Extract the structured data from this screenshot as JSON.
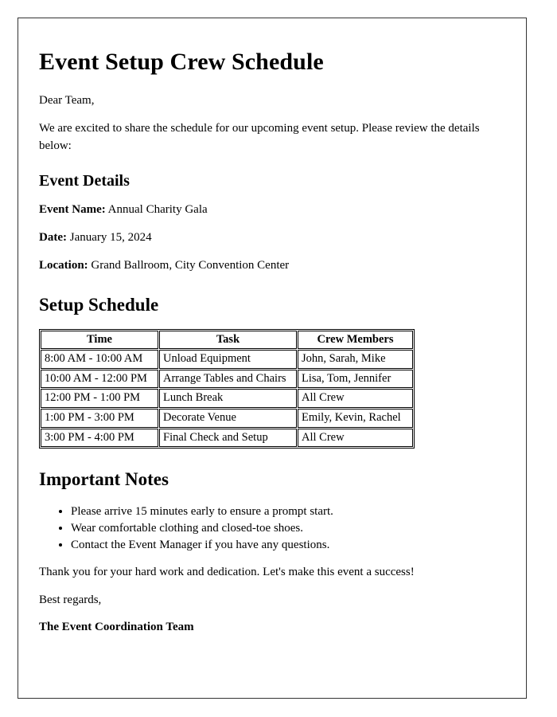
{
  "document": {
    "title": "Event Setup Crew Schedule",
    "greeting": "Dear Team,",
    "intro": "We are excited to share the schedule for our upcoming event setup. Please review the details below:"
  },
  "event_details": {
    "heading": "Event Details",
    "fields": [
      {
        "label": "Event Name:",
        "value": "Annual Charity Gala"
      },
      {
        "label": "Date:",
        "value": "January 15, 2024"
      },
      {
        "label": "Location:",
        "value": "Grand Ballroom, City Convention Center"
      }
    ]
  },
  "setup_schedule": {
    "heading": "Setup Schedule",
    "columns": [
      "Time",
      "Task",
      "Crew Members"
    ],
    "rows": [
      [
        "8:00 AM - 10:00 AM",
        "Unload Equipment",
        "John, Sarah, Mike"
      ],
      [
        "10:00 AM - 12:00 PM",
        "Arrange Tables and Chairs",
        "Lisa, Tom, Jennifer"
      ],
      [
        "12:00 PM - 1:00 PM",
        "Lunch Break",
        "All Crew"
      ],
      [
        "1:00 PM - 3:00 PM",
        "Decorate Venue",
        "Emily, Kevin, Rachel"
      ],
      [
        "3:00 PM - 4:00 PM",
        "Final Check and Setup",
        "All Crew"
      ]
    ]
  },
  "important_notes": {
    "heading": "Important Notes",
    "items": [
      "Please arrive 15 minutes early to ensure a prompt start.",
      "Wear comfortable clothing and closed-toe shoes.",
      "Contact the Event Manager if you have any questions."
    ]
  },
  "closing": {
    "thanks": "Thank you for your hard work and dedication. Let's make this event a success!",
    "regards": "Best regards,",
    "signature": "The Event Coordination Team"
  }
}
